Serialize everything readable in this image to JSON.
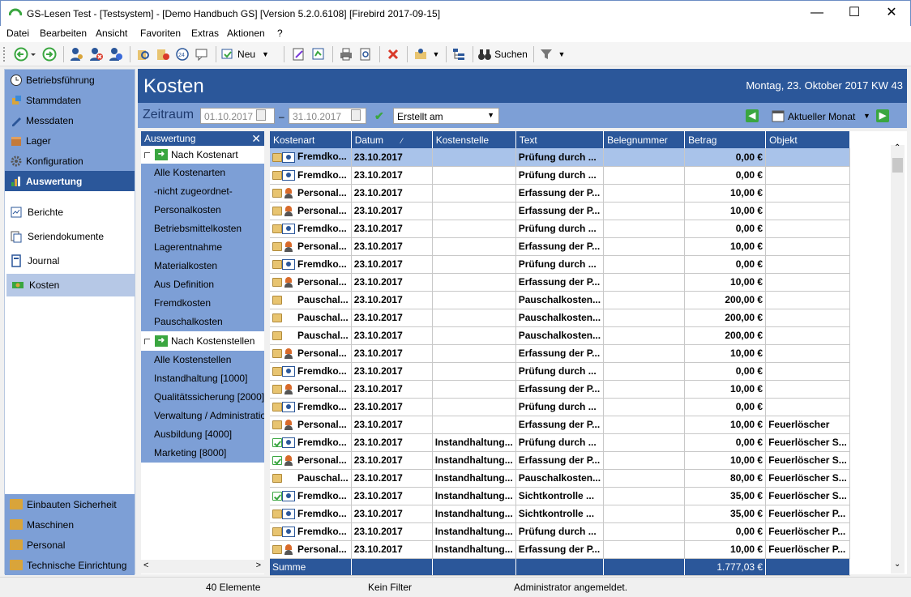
{
  "window": {
    "title": "GS-Lesen Test - [Testsystem] - [Demo Handbuch GS]  [Version  5.2.0.6108]  [Firebird 2017-09-15]",
    "minimize": "—",
    "maximize": "☐",
    "close": "✕"
  },
  "menu": [
    "Datei",
    "Bearbeiten",
    "Ansicht",
    "Favoriten",
    "Extras",
    "Aktionen",
    "?"
  ],
  "toolbar": {
    "new_label": "Neu",
    "search_label": "Suchen"
  },
  "nav": {
    "top_items": [
      {
        "label": "Betriebsführung",
        "icon": "clock-icon"
      },
      {
        "label": "Stammdaten",
        "icon": "cube-icon"
      },
      {
        "label": "Messdaten",
        "icon": "pen-icon"
      },
      {
        "label": "Lager",
        "icon": "box-icon"
      },
      {
        "label": "Konfiguration",
        "icon": "gear-icon"
      },
      {
        "label": "Auswertung",
        "icon": "chart-icon"
      }
    ],
    "sub_items": [
      {
        "label": "Berichte",
        "icon": "report-icon"
      },
      {
        "label": "Seriendokumente",
        "icon": "documents-icon"
      },
      {
        "label": "Journal",
        "icon": "journal-icon"
      },
      {
        "label": "Kosten",
        "icon": "money-icon"
      }
    ],
    "bottom_items": [
      {
        "label": "Einbauten Sicherheit",
        "icon": "folder-icon"
      },
      {
        "label": "Maschinen",
        "icon": "folder-icon"
      },
      {
        "label": "Personal",
        "icon": "folder-icon"
      },
      {
        "label": "Technische Einrichtung",
        "icon": "folder-icon"
      }
    ]
  },
  "header": {
    "title": "Kosten",
    "date": "Montag, 23. Oktober 2017  KW 43"
  },
  "filter": {
    "label": "Zeitraum",
    "from": "01.10.2017",
    "dash": "–",
    "to": "31.10.2017",
    "date_type": "Erstellt am",
    "period": "Aktueller Monat"
  },
  "tree": {
    "header": "Auswertung",
    "close": "✕",
    "group1": "Nach Kostenart",
    "group1_items": [
      "Alle Kostenarten",
      "-nicht zugeordnet-",
      "Personalkosten",
      "Betriebsmittelkosten",
      "Lagerentnahme",
      "Materialkosten",
      "Aus Definition",
      "Fremdkosten",
      "Pauschalkosten"
    ],
    "group2": "Nach Kostenstellen",
    "group2_items": [
      "Alle Kostenstellen",
      "Instandhaltung [1000]",
      "Qualitätssicherung [2000]",
      "Verwaltung / Administration",
      "Ausbildung [4000]",
      "Marketing [8000]"
    ],
    "scroll_left": "<",
    "scroll_right": ">"
  },
  "table": {
    "columns": [
      "Kostenart",
      "Datum",
      "Kostenstelle",
      "Text",
      "Belegnummer",
      "Betrag",
      "Objekt"
    ],
    "rows": [
      {
        "icon": "fremd",
        "kostenart": "Fremdko...",
        "datum": "23.10.2017",
        "kostenstelle": "",
        "text": "Prüfung durch ...",
        "beleg": "",
        "betrag": "0,00 €",
        "objekt": ""
      },
      {
        "icon": "fremd",
        "kostenart": "Fremdko...",
        "datum": "23.10.2017",
        "kostenstelle": "",
        "text": "Prüfung durch ...",
        "beleg": "",
        "betrag": "0,00 €",
        "objekt": ""
      },
      {
        "icon": "person",
        "kostenart": "Personal...",
        "datum": "23.10.2017",
        "kostenstelle": "",
        "text": "Erfassung der P...",
        "beleg": "",
        "betrag": "10,00 €",
        "objekt": ""
      },
      {
        "icon": "person",
        "kostenart": "Personal...",
        "datum": "23.10.2017",
        "kostenstelle": "",
        "text": "Erfassung der P...",
        "beleg": "",
        "betrag": "10,00 €",
        "objekt": ""
      },
      {
        "icon": "fremd",
        "kostenart": "Fremdko...",
        "datum": "23.10.2017",
        "kostenstelle": "",
        "text": "Prüfung durch ...",
        "beleg": "",
        "betrag": "0,00 €",
        "objekt": ""
      },
      {
        "icon": "person",
        "kostenart": "Personal...",
        "datum": "23.10.2017",
        "kostenstelle": "",
        "text": "Erfassung der P...",
        "beleg": "",
        "betrag": "10,00 €",
        "objekt": ""
      },
      {
        "icon": "fremd",
        "kostenart": "Fremdko...",
        "datum": "23.10.2017",
        "kostenstelle": "",
        "text": "Prüfung durch ...",
        "beleg": "",
        "betrag": "0,00 €",
        "objekt": ""
      },
      {
        "icon": "person",
        "kostenart": "Personal...",
        "datum": "23.10.2017",
        "kostenstelle": "",
        "text": "Erfassung der P...",
        "beleg": "",
        "betrag": "10,00 €",
        "objekt": ""
      },
      {
        "icon": "pausch",
        "kostenart": "Pauschal...",
        "datum": "23.10.2017",
        "kostenstelle": "",
        "text": "Pauschalkosten...",
        "beleg": "",
        "betrag": "200,00 €",
        "objekt": ""
      },
      {
        "icon": "pausch",
        "kostenart": "Pauschal...",
        "datum": "23.10.2017",
        "kostenstelle": "",
        "text": "Pauschalkosten...",
        "beleg": "",
        "betrag": "200,00 €",
        "objekt": ""
      },
      {
        "icon": "pausch",
        "kostenart": "Pauschal...",
        "datum": "23.10.2017",
        "kostenstelle": "",
        "text": "Pauschalkosten...",
        "beleg": "",
        "betrag": "200,00 €",
        "objekt": ""
      },
      {
        "icon": "person",
        "kostenart": "Personal...",
        "datum": "23.10.2017",
        "kostenstelle": "",
        "text": "Erfassung der P...",
        "beleg": "",
        "betrag": "10,00 €",
        "objekt": ""
      },
      {
        "icon": "fremd",
        "kostenart": "Fremdko...",
        "datum": "23.10.2017",
        "kostenstelle": "",
        "text": "Prüfung durch ...",
        "beleg": "",
        "betrag": "0,00 €",
        "objekt": ""
      },
      {
        "icon": "person",
        "kostenart": "Personal...",
        "datum": "23.10.2017",
        "kostenstelle": "",
        "text": "Erfassung der P...",
        "beleg": "",
        "betrag": "10,00 €",
        "objekt": ""
      },
      {
        "icon": "fremd",
        "kostenart": "Fremdko...",
        "datum": "23.10.2017",
        "kostenstelle": "",
        "text": "Prüfung durch ...",
        "beleg": "",
        "betrag": "0,00 €",
        "objekt": ""
      },
      {
        "icon": "person",
        "kostenart": "Personal...",
        "datum": "23.10.2017",
        "kostenstelle": "",
        "text": "Erfassung der P...",
        "beleg": "",
        "betrag": "10,00 €",
        "objekt": "Feuerlöscher"
      },
      {
        "icon": "fremd-check",
        "kostenart": "Fremdko...",
        "datum": "23.10.2017",
        "kostenstelle": "Instandhaltung...",
        "text": "Prüfung durch ...",
        "beleg": "",
        "betrag": "0,00 €",
        "objekt": "Feuerlöscher S..."
      },
      {
        "icon": "person-check",
        "kostenart": "Personal...",
        "datum": "23.10.2017",
        "kostenstelle": "Instandhaltung...",
        "text": "Erfassung der P...",
        "beleg": "",
        "betrag": "10,00 €",
        "objekt": "Feuerlöscher S..."
      },
      {
        "icon": "pausch",
        "kostenart": "Pauschal...",
        "datum": "23.10.2017",
        "kostenstelle": "Instandhaltung...",
        "text": "Pauschalkosten...",
        "beleg": "",
        "betrag": "80,00 €",
        "objekt": "Feuerlöscher S..."
      },
      {
        "icon": "fremd-check",
        "kostenart": "Fremdko...",
        "datum": "23.10.2017",
        "kostenstelle": "Instandhaltung...",
        "text": "Sichtkontrolle ...",
        "beleg": "",
        "betrag": "35,00 €",
        "objekt": "Feuerlöscher S..."
      },
      {
        "icon": "fremd",
        "kostenart": "Fremdko...",
        "datum": "23.10.2017",
        "kostenstelle": "Instandhaltung...",
        "text": "Sichtkontrolle ...",
        "beleg": "",
        "betrag": "35,00 €",
        "objekt": "Feuerlöscher P..."
      },
      {
        "icon": "fremd",
        "kostenart": "Fremdko...",
        "datum": "23.10.2017",
        "kostenstelle": "Instandhaltung...",
        "text": "Prüfung durch ...",
        "beleg": "",
        "betrag": "0,00 €",
        "objekt": "Feuerlöscher P..."
      },
      {
        "icon": "person",
        "kostenart": "Personal...",
        "datum": "23.10.2017",
        "kostenstelle": "Instandhaltung...",
        "text": "Erfassung der P...",
        "beleg": "",
        "betrag": "10,00 €",
        "objekt": "Feuerlöscher P..."
      }
    ],
    "sum_label": "Summe",
    "sum_value": "1.777,03 €"
  },
  "status": {
    "count": "40 Elemente",
    "filter": "Kein Filter",
    "user": "Administrator angemeldet."
  },
  "colors": {
    "accent": "#2b579a",
    "panel": "#7d9fd6",
    "selection": "#a9c3ea"
  }
}
